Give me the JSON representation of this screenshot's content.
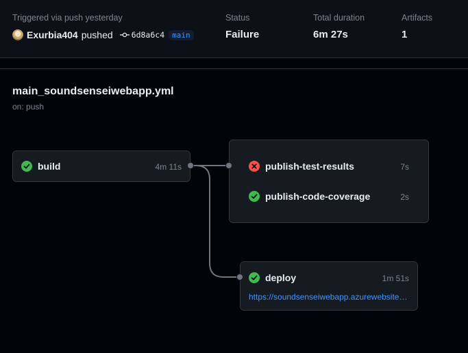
{
  "summary": {
    "trigger_text": "Triggered via push yesterday",
    "user": "Exurbia404",
    "action": "pushed",
    "commit_sha": "6d8a6c4",
    "branch": "main",
    "status_label": "Status",
    "status_value": "Failure",
    "duration_label": "Total duration",
    "duration_value": "6m 27s",
    "artifacts_label": "Artifacts",
    "artifacts_value": "1"
  },
  "workflow": {
    "name": "main_soundsenseiwebapp.yml",
    "trigger": "on: push"
  },
  "jobs": {
    "build": {
      "name": "build",
      "duration": "4m 11s",
      "status": "success"
    },
    "publish_test_results": {
      "name": "publish-test-results",
      "duration": "7s",
      "status": "failure"
    },
    "publish_code_coverage": {
      "name": "publish-code-coverage",
      "duration": "2s",
      "status": "success"
    },
    "deploy": {
      "name": "deploy",
      "duration": "1m 51s",
      "status": "success",
      "url": "https://soundsenseiwebapp.azurewebsites.net"
    }
  },
  "colors": {
    "success": "#3fb950",
    "failure": "#f85149",
    "link": "#4493f8",
    "background": "#010409",
    "card": "#161b22"
  },
  "icons": {
    "success": "check-circle-fill-icon",
    "failure": "x-circle-fill-icon",
    "commit": "git-commit-icon"
  }
}
